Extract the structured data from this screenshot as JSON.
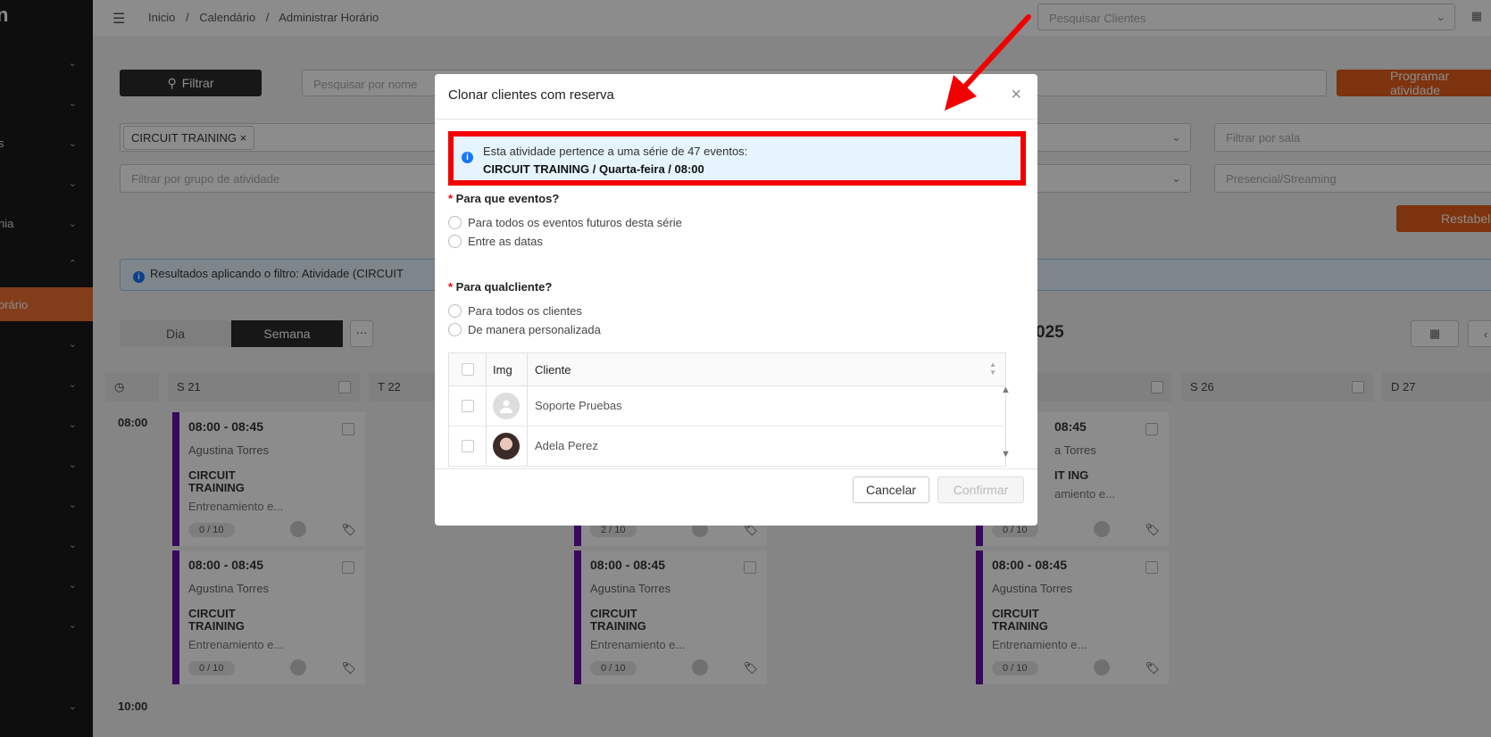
{
  "sidebar": {
    "logo": "n",
    "items": [
      {
        "label": ""
      },
      {
        "label": ""
      },
      {
        "label": "s"
      },
      {
        "label": ""
      },
      {
        "label": "nia"
      },
      {
        "label": ""
      },
      {
        "label": "orário"
      },
      {
        "label": ""
      },
      {
        "label": ""
      },
      {
        "label": ""
      },
      {
        "label": ""
      },
      {
        "label": ""
      },
      {
        "label": ""
      },
      {
        "label": ""
      },
      {
        "label": ""
      },
      {
        "label": ""
      }
    ]
  },
  "topbar": {
    "crumb_home": "Inicio",
    "crumb_calendar": "Calendário",
    "crumb_current": "Administrar Horário",
    "sep": "/",
    "client_search_placeholder": "Pesquisar Clientes"
  },
  "filters": {
    "filter_btn": "Filtrar",
    "name_search_placeholder": "Pesquisar por nome",
    "schedule_btn": "Programar atividade",
    "activity_tag": "CIRCUIT TRAINING",
    "room_placeholder": "Filtrar por sala",
    "group_placeholder": "Filtrar por grupo de atividade",
    "mode_placeholder": "Presencial/Streaming",
    "reset_btn": "Restabelecer",
    "result_text": "Resultados aplicando o filtro: Atividade (CIRCUIT"
  },
  "view": {
    "day": "Dia",
    "week": "Semana",
    "more": "···",
    "year_label": "025"
  },
  "calendar": {
    "days": [
      {
        "label": "S 21"
      },
      {
        "label": "T 22"
      },
      {
        "label": ""
      },
      {
        "label": ""
      },
      {
        "label": ""
      },
      {
        "label": "S 26"
      },
      {
        "label": "D 27"
      }
    ],
    "time_0800": "08:00",
    "time_1000": "10:00",
    "events": [
      {
        "time": "08:00 - 08:45",
        "coach": "Agustina Torres",
        "activity": "CIRCUIT TRAINING",
        "desc": "Entrenamiento e...",
        "cap": "0 / 10"
      },
      {
        "time": "08:00 - 08:45",
        "coach": "Agustina Torres",
        "activity": "CIRCUIT TRAINING",
        "desc": "Entrenamiento e...",
        "cap": "0 / 10"
      },
      {
        "time": "",
        "coach": "",
        "activity": "",
        "desc": "",
        "cap": "2 / 10"
      },
      {
        "time": "08:00 - 08:45",
        "coach": "Agustina Torres",
        "activity": "CIRCUIT TRAINING",
        "desc": "Entrenamiento e...",
        "cap": "0 / 10"
      },
      {
        "time": "08:45",
        "coach": "a Torres",
        "activity": "IT ING",
        "desc": "amiento e...",
        "cap": "0 / 10"
      },
      {
        "time": "08:00 - 08:45",
        "coach": "Agustina Torres",
        "activity": "CIRCUIT TRAINING",
        "desc": "Entrenamiento e...",
        "cap": "0 / 10"
      }
    ]
  },
  "modal": {
    "title": "Clonar clientes com reserva",
    "close": "×",
    "info_line1": "Esta atividade pertence a uma série de 47 eventos:",
    "info_line2": "CIRCUIT TRAINING / Quarta-feira / 08:00",
    "q1": "Para que eventos?",
    "q1_opt1": "Para todos os eventos futuros desta série",
    "q1_opt2": "Entre as datas",
    "q2": "Para qualcliente?",
    "q2_opt1": "Para todos os clientes",
    "q2_opt2": "De manera personalizada",
    "table": {
      "col_img": "Img",
      "col_client": "Cliente",
      "rows": [
        {
          "name": "Soporte Pruebas"
        },
        {
          "name": "Adela Perez"
        }
      ]
    },
    "cancel": "Cancelar",
    "confirm": "Confirmar"
  },
  "colors": {
    "accent_orange": "#e35e1b",
    "event_purple": "#6a0dad",
    "highlight_red": "#f20000",
    "info_blue": "#1677ff"
  }
}
